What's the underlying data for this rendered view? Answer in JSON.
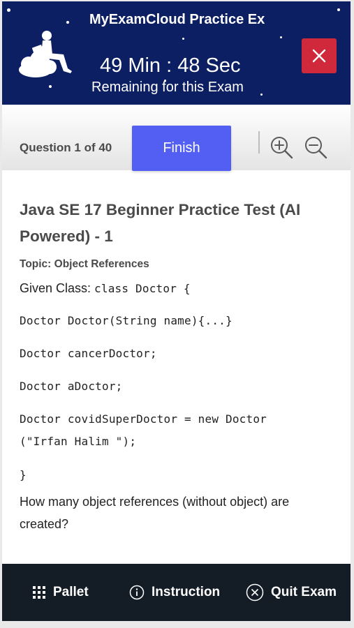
{
  "header": {
    "title": "MyExamCloud Practice Ex",
    "timer": "49 Min : 48 Sec",
    "remaining_label": "Remaining for this Exam",
    "colors": {
      "background": "#0c1f63",
      "close_button": "#d0293b"
    },
    "close_icon": "close-icon",
    "logo_icon": "person-on-cloud-logo"
  },
  "toolbar": {
    "question_counter": "Question 1 of 40",
    "finish_label": "Finish",
    "finish_color": "#535ff2",
    "zoom_in_icon": "zoom-in-icon",
    "zoom_out_icon": "zoom-out-icon"
  },
  "question": {
    "test_title": "Java SE 17 Beginner Practice Test (AI Powered) - 1",
    "topic": "Topic: Object References",
    "given_label": "Given Class: ",
    "given_code": "class Doctor {",
    "code_lines": [
      "Doctor Doctor(String name){...}",
      "Doctor cancerDoctor;",
      "Doctor aDoctor;",
      "Doctor covidSuperDoctor = new Doctor",
      "(\"Irfan Halim \");",
      "}"
    ],
    "prompt": "How many object references (without object) are created?"
  },
  "bottom_bar": {
    "pallet_label": "Pallet",
    "instruction_label": "Instruction",
    "quit_label": "Quit Exam",
    "background": "#141c26"
  }
}
